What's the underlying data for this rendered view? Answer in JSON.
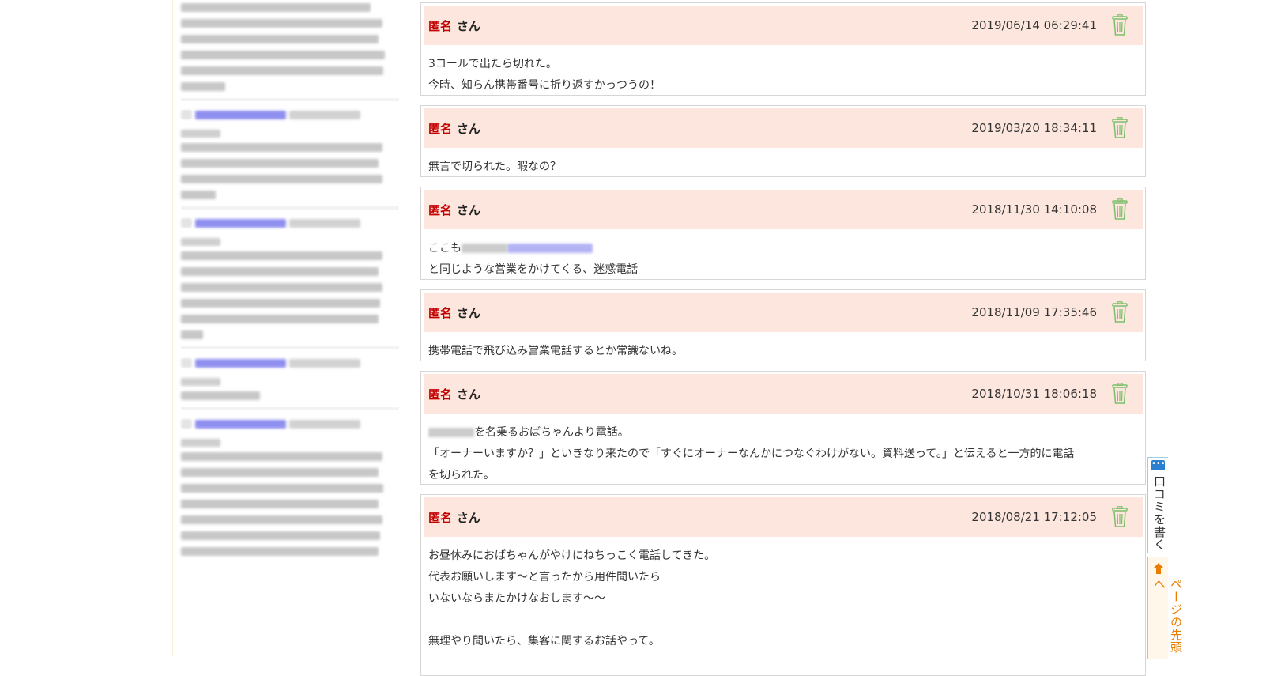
{
  "posts": [
    {
      "author": "匿名",
      "honorific": "さん",
      "date": "2019/06/14 06:29:41",
      "lines": [
        "3コールで出たら切れた。",
        "今時、知らん携帯番号に折り返すかっつうの！"
      ]
    },
    {
      "author": "匿名",
      "honorific": "さん",
      "date": "2019/03/20 18:34:11",
      "lines": [
        "無言で切られた。暇なの？"
      ]
    },
    {
      "author": "匿名",
      "honorific": "さん",
      "date": "2018/11/30 14:10:08",
      "line1_prefix": "ここも",
      "line2": "と同じような営業をかけてくる、迷惑電話"
    },
    {
      "author": "匿名",
      "honorific": "さん",
      "date": "2018/11/09 17:35:46",
      "lines": [
        "携帯電話で飛び込み営業電話するとか常識ないね。"
      ]
    },
    {
      "author": "匿名",
      "honorific": "さん",
      "date": "2018/10/31 18:06:18",
      "line1_suffix": "を名乗るおばちゃんより電話。",
      "line2": "「オーナーいますか？」といきなり来たので「すぐにオーナーなんかにつなぐわけがない。資料送って。」と伝えると一方的に電話",
      "line3": "を切られた。"
    },
    {
      "author": "匿名",
      "honorific": "さん",
      "date": "2018/08/21 17:12:05",
      "lines": [
        "お昼休みにおばちゃんがやけにねちっこく電話してきた。",
        "代表お願いします～と言ったから用件聞いたら",
        "いないならまたかけなおします～～",
        "",
        "無理やり聞いたら、集客に関するお話やって。"
      ]
    }
  ],
  "side_tabs": {
    "write_review": "口コミを書く",
    "page_top": "ページの先頭へ"
  },
  "icons": {
    "delete": "trash-icon",
    "more": "dots-icon",
    "up": "arrow-up-icon"
  },
  "colors": {
    "author_name": "#c30000",
    "post_header_bg": "#fde6dd",
    "trash_icon": "#7bbf6a",
    "page_top_text": "#e87d00",
    "write_tab_border": "#9dcde6"
  }
}
